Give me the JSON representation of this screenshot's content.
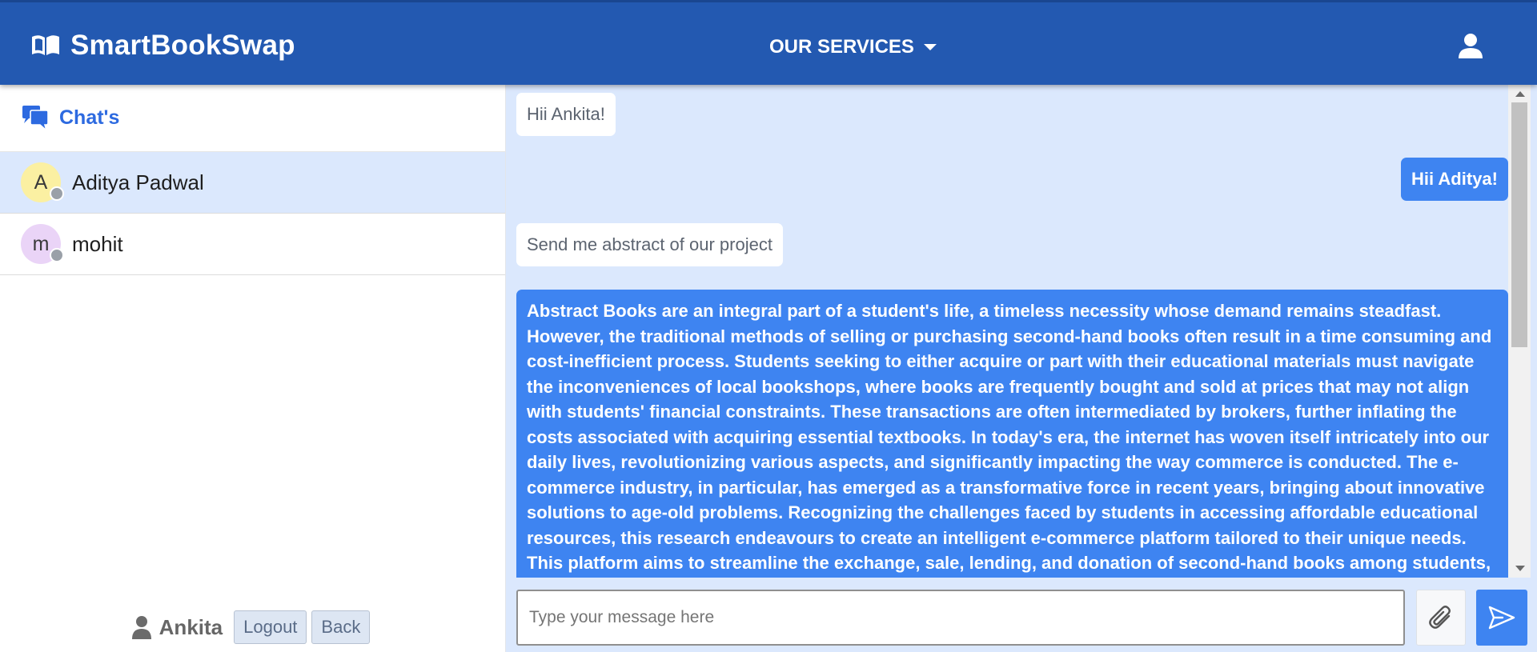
{
  "header": {
    "brand": "SmartBookSwap",
    "services_label": "OUR SERVICES"
  },
  "sidebar": {
    "title": "Chat's",
    "contacts": [
      {
        "initial": "A",
        "name": "Aditya Padwal",
        "avatar_color": "#fbf0a2",
        "active": true
      },
      {
        "initial": "m",
        "name": "mohit",
        "avatar_color": "#ead4f7",
        "active": false
      }
    ],
    "current_user": "Ankita",
    "logout_label": "Logout",
    "back_label": "Back"
  },
  "chat": {
    "messages": [
      {
        "direction": "in",
        "text": "Hii Ankita!"
      },
      {
        "direction": "out",
        "text": "Hii Aditya!"
      },
      {
        "direction": "in",
        "text": "Send me abstract of our project"
      },
      {
        "direction": "out",
        "text": "Abstract Books are an integral part of a student's life, a timeless necessity whose demand remains steadfast. However, the traditional methods of selling or purchasing second-hand books often result in a time consuming and cost-inefficient process. Students seeking to either acquire or part with their educational materials must navigate the inconveniences of local bookshops, where books are frequently bought and sold at prices that may not align with students' financial constraints. These transactions are often intermediated by brokers, further inflating the costs associated with acquiring essential textbooks. In today's era, the internet has woven itself intricately into our daily lives, revolutionizing various aspects, and significantly impacting the way commerce is conducted. The e-commerce industry, in particular, has emerged as a transformative force in recent years, bringing about innovative solutions to age-old problems. Recognizing the challenges faced by students in accessing affordable educational resources, this research endeavours to create an intelligent e-commerce platform tailored to their unique needs. This platform aims to streamline the exchange, sale, lending, and donation of second-hand books among students, allowing them to acquire"
      }
    ],
    "input_placeholder": "Type your message here"
  },
  "colors": {
    "navbar": "#2359b1",
    "accent": "#3e84f1",
    "chat_bg": "#dbe8fd",
    "chats_title": "#2d6ae0"
  },
  "icons": {
    "brand": "open-book-icon",
    "user": "user-icon",
    "chats": "chat-bubbles-icon",
    "attach": "paperclip-icon",
    "send": "paper-plane-icon"
  }
}
